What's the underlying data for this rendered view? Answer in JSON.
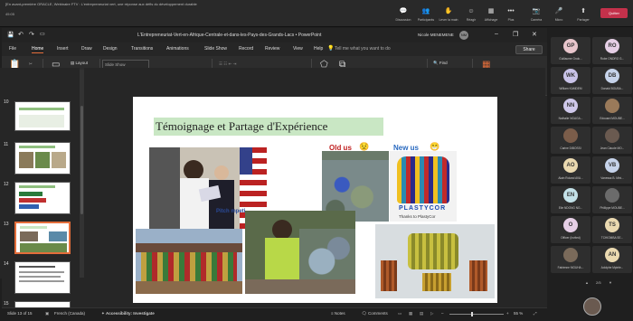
{
  "meeting": {
    "title": "[En avant-première ORACLE, Webinaire FTV : L'entrepreneuriat vert, une réponse aux défis du développement durable",
    "timer": "45:05",
    "controls": [
      {
        "name": "chat",
        "label": "Discussion",
        "icon": "💬"
      },
      {
        "name": "people",
        "label": "Participants",
        "icon": "👥"
      },
      {
        "name": "raise",
        "label": "Lever la main",
        "icon": "✋"
      },
      {
        "name": "react",
        "label": "Réagir",
        "icon": "☺"
      },
      {
        "name": "view",
        "label": "Affichage",
        "icon": "▦"
      },
      {
        "name": "more",
        "label": "Plus",
        "icon": "•••"
      },
      {
        "name": "camera",
        "label": "Caméra",
        "icon": "📷"
      },
      {
        "name": "mic",
        "label": "Micro",
        "icon": "🎤"
      },
      {
        "name": "share",
        "label": "Partager",
        "icon": "⬆"
      }
    ],
    "leave_label": "Quitter"
  },
  "ppt": {
    "doc_title": "L'Entrepreneuriat-Vert-en-Afrique-Centrale-et-dans-les-Pays-des-Grands-Lacs  •  PowerPoint",
    "user": "Nicole MENEMENE",
    "user_initials": "NM",
    "tabs": [
      "File",
      "Home",
      "Insert",
      "Draw",
      "Design",
      "Transitions",
      "Animations",
      "Slide Show",
      "Record",
      "Review",
      "View",
      "Help"
    ],
    "tell_me": "Tell me what you want to do",
    "share_label": "Share",
    "ribbon": {
      "paste": "Paste",
      "new_slide": "New Slide",
      "layout": "Layout",
      "reset": "Reset",
      "section": "Section",
      "layout_box_line1": "Slide Show",
      "layout_box_line2": "Resume Slide Show",
      "shapes": "Shapes",
      "arrange": "Arrange",
      "find": "Find",
      "replace": "Replace",
      "select": "Select",
      "addins": "Add-ins",
      "groups": [
        "Clipboard",
        "Slides",
        "Font",
        "Paragraph",
        "Drawing",
        "Editing",
        "Add-ins"
      ]
    },
    "thumb_numbers": [
      "10",
      "11",
      "12",
      "13",
      "14",
      "15"
    ],
    "slide": {
      "title": "Témoignage et Partage d'Expérience",
      "old_label": "Old us",
      "new_label": "New us",
      "plastycor": "PLASTYCOR",
      "thanks": "Thanks to PlastyCor",
      "pitch_text": "Pitch mpeti"
    },
    "status": {
      "slide_of": "Slide 13 of 15",
      "language": "French (Canada)",
      "accessibility": "Accessibility: Investigate",
      "notes": "Notes",
      "comments": "Comments",
      "zoom": "55 %"
    }
  },
  "participants": {
    "tiles": [
      {
        "initials": "GP",
        "name": "Guillaume Gnok...",
        "color": "#e8c6cc"
      },
      {
        "initials": "RO",
        "name": "Robe ONDRO G...",
        "color": "#e6cfe6"
      },
      {
        "initials": "WK",
        "name": "William KAMDEM",
        "color": "#c9c3e8"
      },
      {
        "initials": "DB",
        "name": "Donald BOUBA...",
        "color": "#c6d3ea"
      },
      {
        "initials": "NN",
        "name": "Nathalie NGAGA...",
        "color": "#cfc8ea"
      },
      {
        "initials": "",
        "name": "Edouard MOUBE...",
        "color": "#9a7a5a"
      },
      {
        "initials": "",
        "name": "Carine DIBOSSI",
        "color": "#7b5d4a"
      },
      {
        "initials": "",
        "name": "Jean Claude MO...",
        "color": "#6a5a50"
      },
      {
        "initials": "AO",
        "name": "Alain Roland AVA...",
        "color": "#ead9b0"
      },
      {
        "initials": "VB",
        "name": "Vanessa B. Mini...",
        "color": "#c6d3ea"
      },
      {
        "initials": "EN",
        "name": "Elie NDONG NG...",
        "color": "#c3e1e8"
      },
      {
        "initials": "",
        "name": "Phillippe MOUBE...",
        "color": "#6b6b6b"
      },
      {
        "initials": "O",
        "name": "Officer (Invited)",
        "color": "#e6cfe6"
      },
      {
        "initials": "TS",
        "name": "TCHIOMBA SE...",
        "color": "#ead9b0"
      },
      {
        "initials": "",
        "name": "Fabienne MOUHA...",
        "color": "#7a6a5a"
      },
      {
        "initials": "AN",
        "name": "Adolphe Mpiele...",
        "color": "#ead9b0"
      }
    ],
    "page": "2/5"
  }
}
